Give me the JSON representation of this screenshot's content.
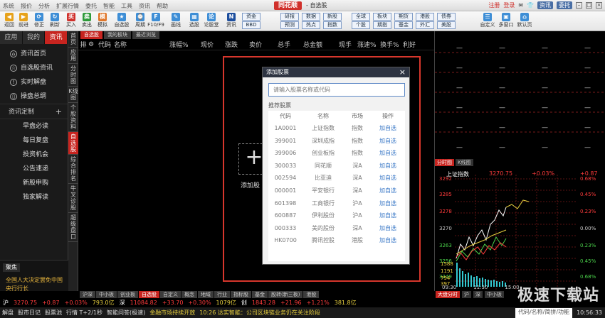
{
  "titlebar": {
    "menu": [
      "系统",
      "报价",
      "分析",
      "扩展行情",
      "委托",
      "智能",
      "工具",
      "资讯",
      "帮助"
    ],
    "brand_logo": "同花顺",
    "brand_sub": "- 自选股",
    "register": "注册",
    "login": "登录",
    "news": "资讯",
    "view": "委托"
  },
  "toolbar": {
    "buttons": [
      "返回",
      "前进",
      "修正",
      "刷新",
      "买入",
      "卖出",
      "模拟",
      "自选股",
      "周期",
      "F10/F9",
      "画线",
      "选股",
      "论股堂",
      "资讯"
    ],
    "boxes": [
      {
        "top": "资金",
        "bottom": "BBD"
      },
      {
        "top": "研报",
        "bottom": "预测"
      },
      {
        "top": "数据",
        "bottom": "热点"
      },
      {
        "top": "新股",
        "bottom": "指数"
      },
      {
        "top": "全球",
        "bottom": "个股"
      },
      {
        "top": "板块",
        "bottom": "期指"
      },
      {
        "top": "期货",
        "bottom": "基金"
      },
      {
        "top": "港股",
        "bottom": "外汇"
      },
      {
        "top": "债券",
        "bottom": "美股"
      }
    ],
    "right": [
      "自定义",
      "多窗口",
      "默认页"
    ]
  },
  "left_nav": {
    "tabs": [
      "应用",
      "我的",
      "资讯"
    ],
    "items": [
      "资讯首页",
      "自选股资讯",
      "实时解盘",
      "操盘总纲"
    ],
    "section": "资讯定制",
    "subitems": [
      "早盘必读",
      "每日复盘",
      "投资机会",
      "公告速递",
      "新股申购",
      "独家解读"
    ],
    "jubao_head": "聚焦",
    "jubao_text": "全国人大决定罢免中国央行行长"
  },
  "vtabs": [
    "首页",
    "应用",
    "分时图",
    "K线图",
    "个股资料",
    "自选股",
    "综合排名",
    "牛叉诊股",
    "超级盘口"
  ],
  "center": {
    "tabs": [
      "自选股",
      "我的板块",
      "最近浏览"
    ],
    "header": [
      "排",
      "代码",
      "名称",
      "涨幅%",
      "现价",
      "涨跌",
      "卖价",
      "总手",
      "总金额",
      "现手",
      "涨速%",
      "换手%",
      "利好"
    ],
    "add_label": "添加股"
  },
  "dialog": {
    "title": "添加股票",
    "search_placeholder": "请输入股票名称或代码",
    "recommend": "推荐股票",
    "cols": [
      "代码",
      "名称",
      "市场",
      "操作"
    ],
    "rows": [
      [
        "1A0001",
        "上证指数",
        "指数",
        "加自选"
      ],
      [
        "399001",
        "深圳成指",
        "指数",
        "加自选"
      ],
      [
        "399006",
        "创业板指",
        "指数",
        "加自选"
      ],
      [
        "300033",
        "同花顺",
        "深A",
        "加自选"
      ],
      [
        "002594",
        "比亚迪",
        "深A",
        "加自选"
      ],
      [
        "000001",
        "平安银行",
        "深A",
        "加自选"
      ],
      [
        "601398",
        "工商银行",
        "沪A",
        "加自选"
      ],
      [
        "600887",
        "伊利股份",
        "沪A",
        "加自选"
      ],
      [
        "000333",
        "美的股份",
        "深A",
        "加自选"
      ],
      [
        "HK0700",
        "腾讯控股",
        "港股",
        "加自选"
      ]
    ]
  },
  "right_panel": {
    "tabs": [
      "分时图",
      "K线图"
    ],
    "title": "上证指数",
    "price": "3270.75",
    "pct": "+0.03%",
    "change": "+0.87",
    "left_axis": [
      "3292",
      "3285",
      "3278",
      "3270",
      "3263",
      "3256",
      "3249"
    ],
    "right_axis": [
      "0.68%",
      "0.45%",
      "0.23%",
      "0.00%",
      "0.23%",
      "0.45%",
      "0.68%"
    ],
    "volume_axis": [
      "1588",
      "1191",
      "794",
      "397"
    ],
    "times": [
      "09:30",
      "11:30",
      "15:00"
    ],
    "flow_labels": [
      "大盘分时",
      "沪",
      "深",
      "中小板"
    ]
  },
  "bottom_tabs": [
    "沪深",
    "中小板",
    "创业板",
    "自选股",
    "自定义",
    "概念",
    "地域",
    "行业",
    "指标股",
    "基金",
    "股转(新三板)",
    "港股"
  ],
  "indices": [
    {
      "name": "沪",
      "price": "3270.75",
      "chg": "+0.87",
      "pct": "+0.03%",
      "amt": "793.0亿"
    },
    {
      "name": "深",
      "price": "11084.82",
      "chg": "+33.70",
      "pct": "+0.30%",
      "amt": "1079亿"
    },
    {
      "name": "创",
      "price": "1843.28",
      "chg": "+21.96",
      "pct": "+1.21%",
      "amt": "381.8亿"
    }
  ],
  "statusbar": [
    "解盘",
    "股市日记",
    "股票池",
    "行情 T+2/1秒",
    "智能问答(极速)",
    "金融市场持续开放",
    "10:26 达实智能：公司区块链业务仍在关注阶段"
  ],
  "statusbar_right": [
    "代码/名称/简拼/功能",
    "10:56:33"
  ],
  "watermark": "极速下载站"
}
